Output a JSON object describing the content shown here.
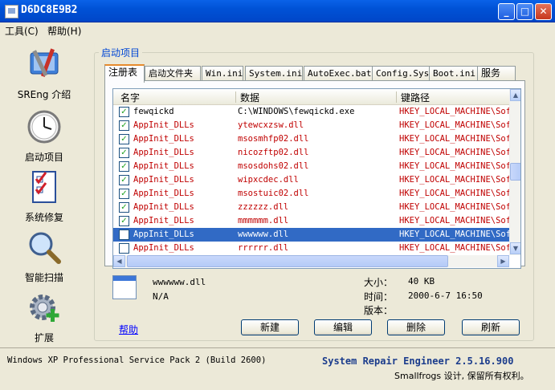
{
  "window": {
    "title": "D6DC8E9B2"
  },
  "menu": {
    "items": [
      "工具(C)",
      "帮助(H)"
    ]
  },
  "sidebar": {
    "items": [
      {
        "label": "SREng 介绍",
        "icon": "tools-icon"
      },
      {
        "label": "启动项目",
        "icon": "clock-icon"
      },
      {
        "label": "系统修复",
        "icon": "checklist-icon"
      },
      {
        "label": "智能扫描",
        "icon": "magnifier-icon"
      },
      {
        "label": "扩展",
        "icon": "gear-plus-icon"
      }
    ]
  },
  "group": {
    "label": "启动项目"
  },
  "tabs": [
    "注册表",
    "启动文件夹",
    "Win.ini",
    "System.ini",
    "AutoExec.bat",
    "Config.Sys",
    "Boot.ini",
    "服务"
  ],
  "active_tab": "注册表",
  "list": {
    "columns": [
      "名字",
      "数据",
      "键路径"
    ],
    "rows": [
      {
        "name": "fewqickd",
        "data": "C:\\WINDOWS\\fewqickd.exe",
        "path": "HKEY_LOCAL_MACHINE\\Sof",
        "checked": true,
        "red": false,
        "selected": false
      },
      {
        "name": "AppInit_DLLs",
        "data": "ytewcxzsw.dll",
        "path": "HKEY_LOCAL_MACHINE\\Sof",
        "checked": true,
        "red": true,
        "selected": false
      },
      {
        "name": "AppInit_DLLs",
        "data": "msosmhfp02.dll",
        "path": "HKEY_LOCAL_MACHINE\\Sof",
        "checked": true,
        "red": true,
        "selected": false
      },
      {
        "name": "AppInit_DLLs",
        "data": "nicozftp02.dll",
        "path": "HKEY_LOCAL_MACHINE\\Sof",
        "checked": true,
        "red": true,
        "selected": false
      },
      {
        "name": "AppInit_DLLs",
        "data": "msosdohs02.dll",
        "path": "HKEY_LOCAL_MACHINE\\Sof",
        "checked": true,
        "red": true,
        "selected": false
      },
      {
        "name": "AppInit_DLLs",
        "data": "wipxcdec.dll",
        "path": "HKEY_LOCAL_MACHINE\\Sof",
        "checked": true,
        "red": true,
        "selected": false
      },
      {
        "name": "AppInit_DLLs",
        "data": "msostuic02.dll",
        "path": "HKEY_LOCAL_MACHINE\\Sof",
        "checked": true,
        "red": true,
        "selected": false
      },
      {
        "name": "AppInit_DLLs",
        "data": "zzzzzz.dll",
        "path": "HKEY_LOCAL_MACHINE\\Sof",
        "checked": true,
        "red": true,
        "selected": false
      },
      {
        "name": "AppInit_DLLs",
        "data": "mmmmmm.dll",
        "path": "HKEY_LOCAL_MACHINE\\Sof",
        "checked": true,
        "red": true,
        "selected": false
      },
      {
        "name": "AppInit_DLLs",
        "data": "wwwwww.dll",
        "path": "HKEY_LOCAL_MACHINE\\Sof",
        "checked": false,
        "red": true,
        "selected": true
      },
      {
        "name": "AppInit_DLLs",
        "data": "rrrrrr.dll",
        "path": "HKEY_LOCAL_MACHINE\\Sof",
        "checked": false,
        "red": true,
        "selected": false
      }
    ]
  },
  "details": {
    "file_name": "wwwwww.dll",
    "publisher": "N/A",
    "size_label": "大小：",
    "size_value": "40 KB",
    "time_label": "时间：",
    "time_value": "2000-6-7 16:50",
    "version_label": "版本："
  },
  "actions": {
    "help": "帮助",
    "new": "新建",
    "edit": "编辑",
    "delete": "删除",
    "refresh": "刷新"
  },
  "status": {
    "os": "Windows XP Professional Service Pack 2 (Build 2600)",
    "product": "System Repair Engineer 2.5.16.900",
    "copyright": "Smallfrogs 设计, 保留所有权利。"
  }
}
